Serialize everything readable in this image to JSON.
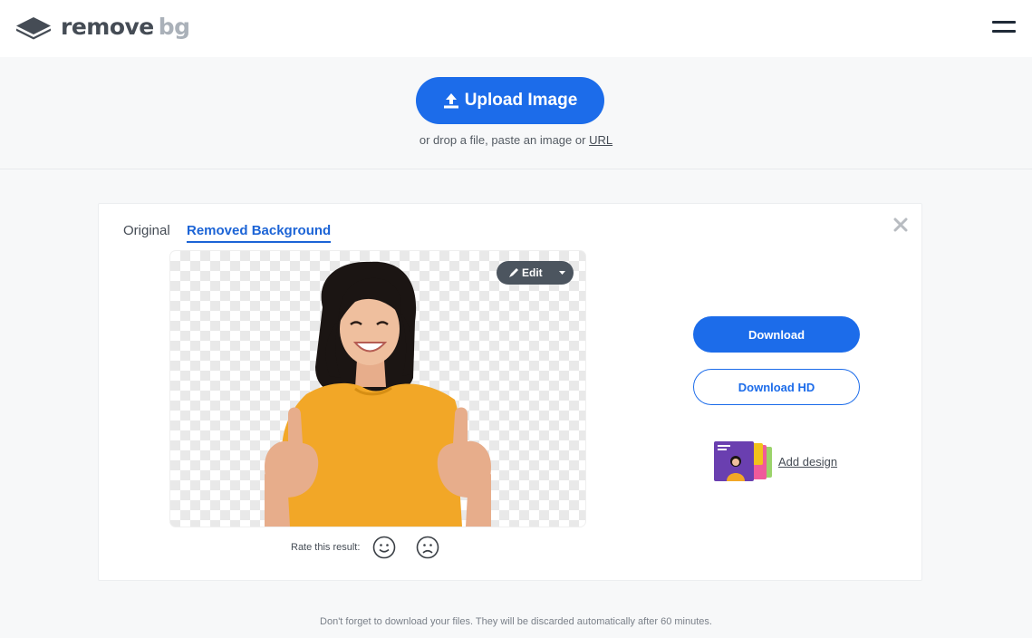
{
  "header": {
    "logo_word1": "remove",
    "logo_word2": "bg",
    "logo_icon": "layers-logo-icon",
    "menu_icon": "hamburger-menu-icon"
  },
  "upload": {
    "button_label": "Upload Image",
    "button_icon": "upload-arrow-icon",
    "hint_text": "or drop a file, paste an image or",
    "hint_link": "URL"
  },
  "result": {
    "tabs": [
      {
        "label": "Original",
        "active": false
      },
      {
        "label": "Removed Background",
        "active": true
      }
    ],
    "close_icon": "close-x-icon",
    "edit_label": "Edit",
    "edit_icon": "brush-icon",
    "rate_label": "Rate this result:",
    "rate_good_icon": "smiley-face-icon",
    "rate_bad_icon": "sad-face-icon",
    "download_label": "Download",
    "download_hd_label": "Download HD",
    "add_design_label": "Add design"
  },
  "footer": {
    "note": "Don't forget to download your files. They will be discarded automatically after 60 minutes."
  },
  "colors": {
    "accent": "#1c6cea",
    "tab_active": "#1c64d6",
    "edit_pill": "#4c555f",
    "shirt": "#f2a727",
    "text": "#454c55"
  }
}
